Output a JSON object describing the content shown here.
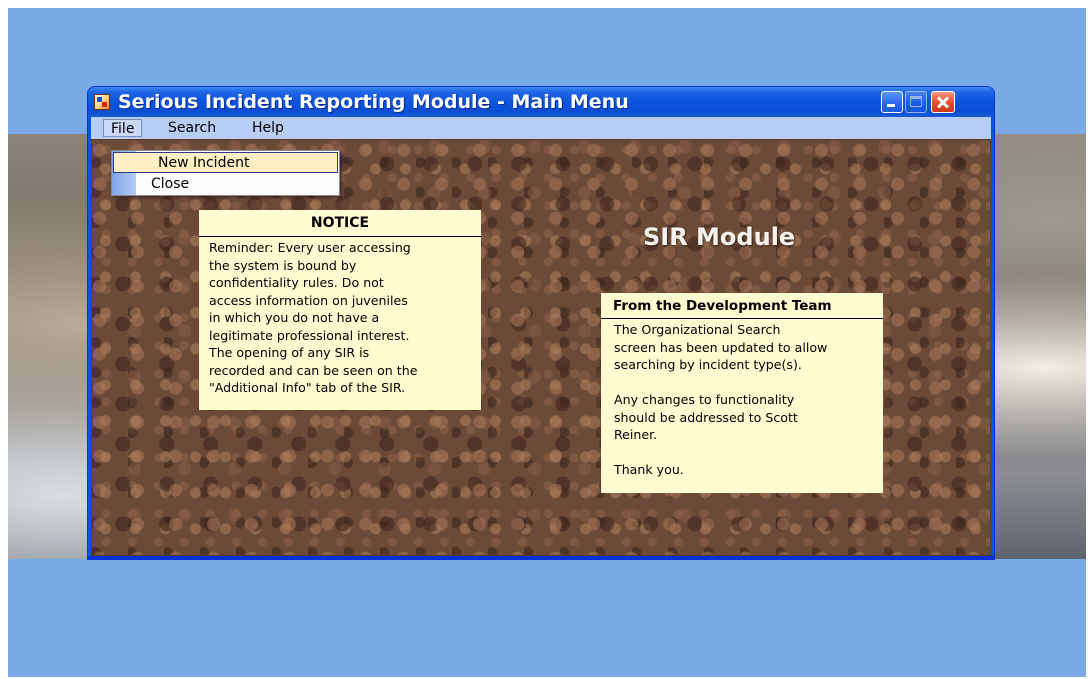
{
  "window": {
    "title": "Serious Incident Reporting Module - Main Menu"
  },
  "menubar": {
    "items": [
      "File",
      "Search",
      "Help"
    ]
  },
  "file_menu": {
    "items": [
      "New Incident",
      "Close"
    ],
    "highlighted": "New Incident"
  },
  "notice": {
    "title": "NOTICE",
    "lines": [
      "Reminder:  Every user accessing",
      "the system is bound by",
      "confidentiality rules.  Do not",
      "access information on juveniles",
      "in which you do not have a",
      "legitimate professional interest.",
      "The opening of any SIR is",
      "recorded and can be seen on the",
      "\"Additional Info\" tab of the SIR."
    ]
  },
  "module_title": "SIR Module",
  "dev_team": {
    "title": "From the Development Team",
    "lines": [
      "The Organizational Search",
      "screen has been updated to allow",
      "searching by incident type(s).",
      "",
      "Any changes to functionality",
      "should be addressed to Scott",
      "Reiner.",
      "",
      "Thank you."
    ]
  },
  "colors": {
    "desktop": "#7aaae6",
    "titlebar": "#0a55dd",
    "notice_bg": "#fffbd0",
    "client_texture": "#6b4a38"
  },
  "icons": {
    "app": "app-form-icon",
    "minimize": "minimize-icon",
    "maximize": "maximize-icon",
    "close": "close-icon"
  }
}
